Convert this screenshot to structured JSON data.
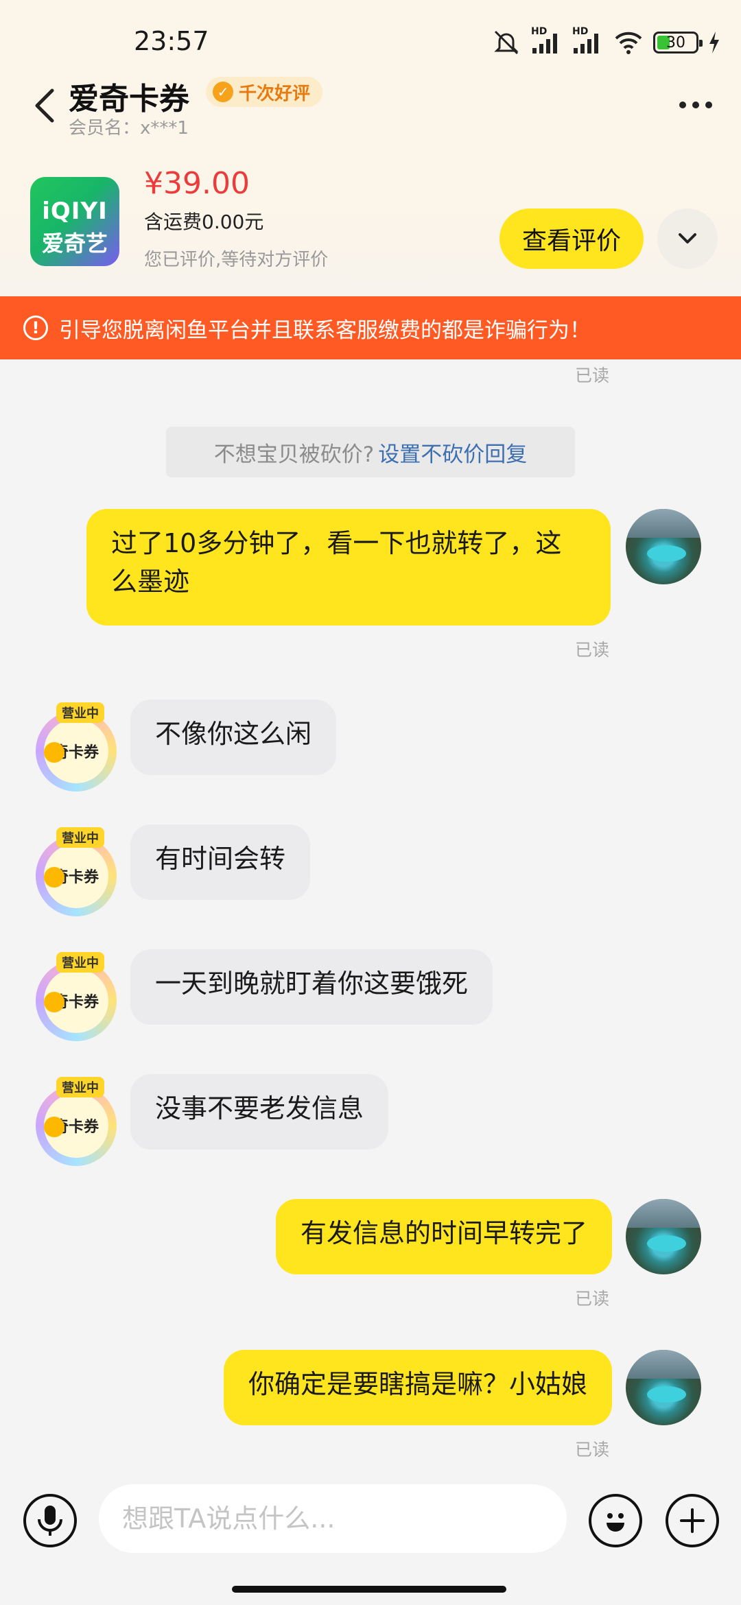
{
  "status_bar": {
    "time": "23:57",
    "battery": "30",
    "network_1": "HD",
    "network_2": "HD"
  },
  "header": {
    "title": "爱奇卡券",
    "badge": "千次好评",
    "member": "会员名：x***1"
  },
  "product": {
    "logo_line1": "iQIYI",
    "logo_line2": "爱奇艺",
    "price": "¥39.00",
    "shipping": "含运费0.00元",
    "review_status": "您已评价,等待对方评价",
    "review_button": "查看评价"
  },
  "warning": {
    "text": "引导您脱离闲鱼平台并且联系客服缴费的都是诈骗行为！"
  },
  "chat": {
    "read_label": "已读",
    "tip_text": "不想宝贝被砍价?",
    "tip_link": "设置不砍价回复",
    "avatar_tag": "营业中",
    "avatar_name": "奇卡券",
    "messages": [
      {
        "from": "me",
        "text": "过了10多分钟了，看一下也就转了，这么墨迹"
      },
      {
        "from": "them",
        "text": "不像你这么闲"
      },
      {
        "from": "them",
        "text": "有时间会转"
      },
      {
        "from": "them",
        "text": "一天到晚就盯着你这要饿死"
      },
      {
        "from": "them",
        "text": "没事不要老发信息"
      },
      {
        "from": "me",
        "text": "有发信息的时间早转完了"
      },
      {
        "from": "me",
        "text": "你确定是要瞎搞是嘛？小姑娘"
      }
    ]
  },
  "input": {
    "placeholder": "想跟TA说点什么..."
  },
  "colors": {
    "accent_yellow": "#ffe51e",
    "warning_orange": "#ff5a23",
    "price_red": "#ec3b3b",
    "link_blue": "#3e6fb0"
  },
  "icons": [
    "back-icon",
    "more-icon",
    "mute-icon",
    "signal-icon",
    "wifi-icon",
    "battery-icon",
    "charging-icon",
    "chevron-down-icon",
    "alert-icon",
    "mic-icon",
    "emoji-icon",
    "plus-icon"
  ]
}
